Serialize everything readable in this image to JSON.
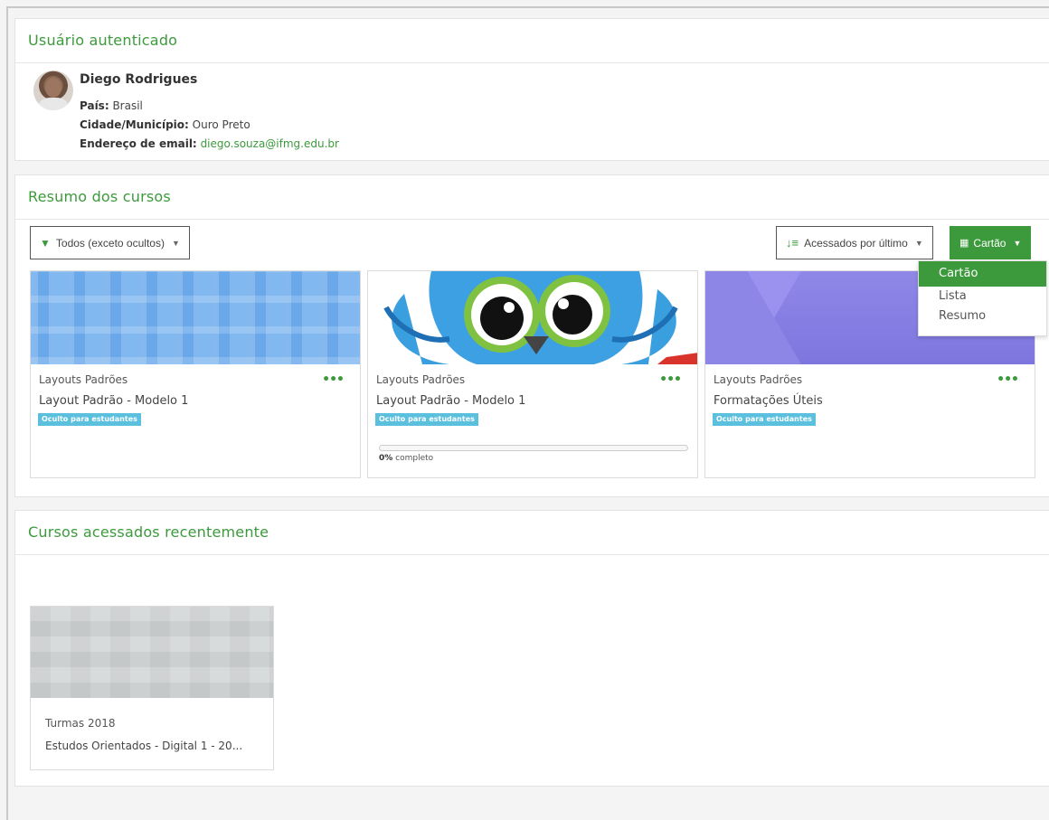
{
  "user_block": {
    "title": "Usuário autenticado",
    "name": "Diego Rodrigues",
    "country_label": "País:",
    "country": "Brasil",
    "city_label": "Cidade/Município:",
    "city": "Ouro Preto",
    "email_label": "Endereço de email:",
    "email": "diego.souza@ifmg.edu.br"
  },
  "overview": {
    "title": "Resumo dos cursos",
    "filter_label": "Todos (exceto ocultos)",
    "sort_label": "Acessados por último",
    "view_label": "Cartão",
    "view_menu": [
      "Cartão",
      "Lista",
      "Resumo"
    ],
    "courses": [
      {
        "category": "Layouts Padrões",
        "name": "Layout Padrão - Modelo 1",
        "badge": "Oculto para estudantes"
      },
      {
        "category": "Layouts Padrões",
        "name": "Layout Padrão - Modelo 1",
        "badge": "Oculto para estudantes",
        "progress_value": "0%",
        "progress_suffix": " completo"
      },
      {
        "category": "Layouts Padrões",
        "name": "Formatações Úteis",
        "badge": "Oculto para estudantes"
      }
    ],
    "menu_icon": "ellipsis-icon"
  },
  "recent": {
    "title": "Cursos acessados recentemente",
    "courses": [
      {
        "category": "Turmas 2018",
        "name": "Estudos Orientados - Digital 1 - 20..."
      }
    ]
  },
  "colors": {
    "accent": "#3c9a3c",
    "badge": "#5bc0de"
  }
}
